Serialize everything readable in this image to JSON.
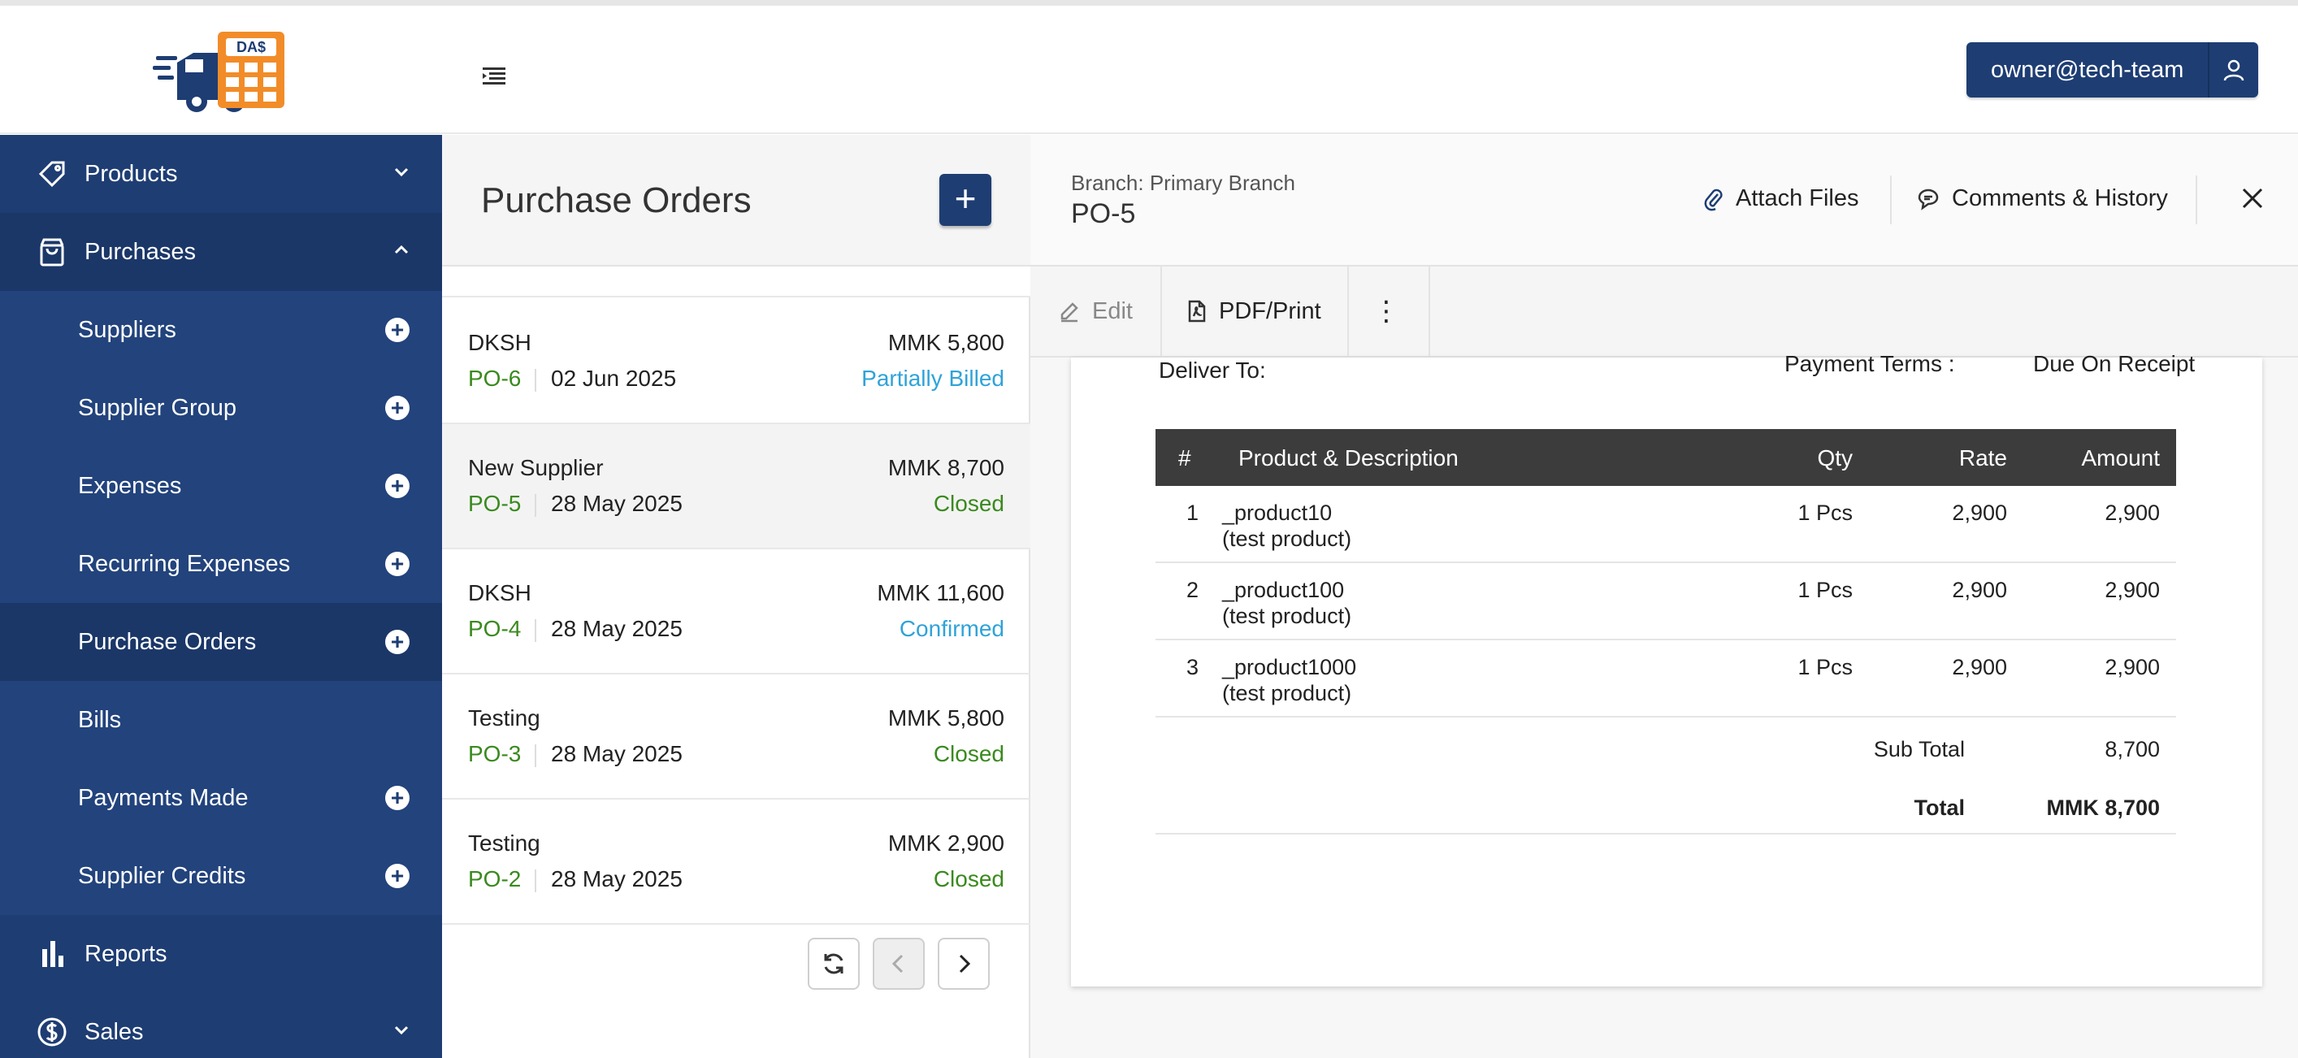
{
  "header": {
    "logo_text": "DA$",
    "user_email": "owner@tech-team"
  },
  "sidebar": {
    "items": [
      {
        "label": "Products"
      },
      {
        "label": "Purchases"
      },
      {
        "label": "Suppliers"
      },
      {
        "label": "Supplier Group"
      },
      {
        "label": "Expenses"
      },
      {
        "label": "Recurring Expenses"
      },
      {
        "label": "Purchase Orders"
      },
      {
        "label": "Bills"
      },
      {
        "label": "Payments Made"
      },
      {
        "label": "Supplier Credits"
      },
      {
        "label": "Reports"
      },
      {
        "label": "Sales"
      }
    ]
  },
  "list": {
    "title": "Purchase Orders",
    "add_label": "+",
    "orders": [
      {
        "supplier": "DKSH",
        "amount": "MMK 5,800",
        "po": "PO-6",
        "date": "02 Jun 2025",
        "status": "Partially Billed"
      },
      {
        "supplier": "New Supplier",
        "amount": "MMK 8,700",
        "po": "PO-5",
        "date": "28 May 2025",
        "status": "Closed"
      },
      {
        "supplier": "DKSH",
        "amount": "MMK 11,600",
        "po": "PO-4",
        "date": "28 May 2025",
        "status": "Confirmed"
      },
      {
        "supplier": "Testing",
        "amount": "MMK 5,800",
        "po": "PO-3",
        "date": "28 May 2025",
        "status": "Closed"
      },
      {
        "supplier": "Testing",
        "amount": "MMK 2,900",
        "po": "PO-2",
        "date": "28 May 2025",
        "status": "Closed"
      }
    ]
  },
  "detail": {
    "branch": "Branch: Primary Branch",
    "po_number": "PO-5",
    "attach_label": "Attach Files",
    "comments_label": "Comments & History",
    "edit_label": "Edit",
    "pdf_label": "PDF/Print",
    "more_label": "⋮",
    "deliver_to": "Deliver To:",
    "payment_terms_label": "Payment Terms :",
    "payment_terms_value": "Due On Receipt",
    "table": {
      "headers": {
        "num": "#",
        "desc": "Product & Description",
        "qty": "Qty",
        "rate": "Rate",
        "amount": "Amount"
      },
      "rows": [
        {
          "num": "1",
          "name": "_product10",
          "desc": "(test product)",
          "qty": "1 Pcs",
          "rate": "2,900",
          "amount": "2,900"
        },
        {
          "num": "2",
          "name": "_product100",
          "desc": "(test product)",
          "qty": "1 Pcs",
          "rate": "2,900",
          "amount": "2,900"
        },
        {
          "num": "3",
          "name": "_product1000",
          "desc": "(test product)",
          "qty": "1 Pcs",
          "rate": "2,900",
          "amount": "2,900"
        }
      ],
      "subtotal_label": "Sub Total",
      "subtotal_value": "8,700",
      "total_label": "Total",
      "total_value": "MMK 8,700"
    }
  },
  "colors": {
    "brand_navy": "#1e3d73",
    "status_green": "#3a8a1e",
    "status_blue": "#2fa3d8",
    "logo_orange": "#f28c28"
  }
}
